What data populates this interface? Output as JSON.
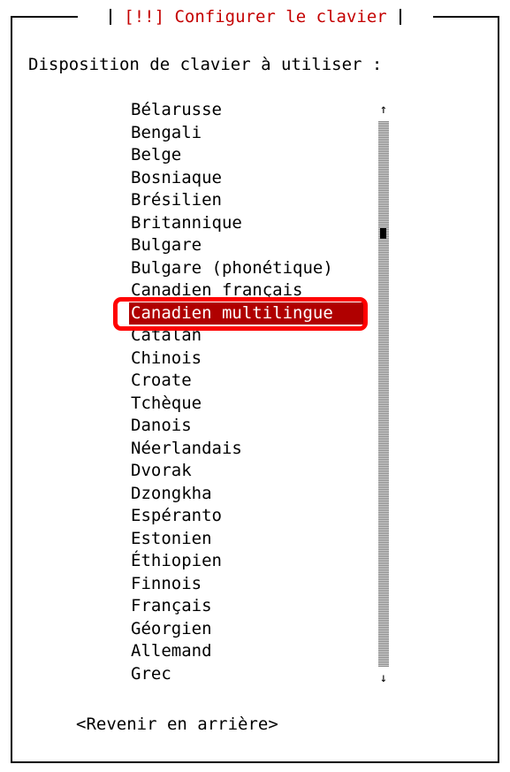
{
  "dialog": {
    "title": "[!!] Configurer le clavier",
    "prompt": "Disposition de clavier à utiliser :",
    "back_label": "<Revenir en arrière>"
  },
  "layouts": [
    "Bélarusse",
    "Bengali",
    "Belge",
    "Bosniaque",
    "Brésilien",
    "Britannique",
    "Bulgare",
    "Bulgare (phonétique)",
    "Canadien français",
    "Canadien multilingue",
    "Catalan",
    "Chinois",
    "Croate",
    "Tchèque",
    "Danois",
    "Néerlandais",
    "Dvorak",
    "Dzongkha",
    "Espéranto",
    "Estonien",
    "Éthiopien",
    "Finnois",
    "Français",
    "Géorgien",
    "Allemand",
    "Grec"
  ],
  "selected_layout": "Canadien multilingue",
  "scrollbar": {
    "up_arrow": "↑",
    "down_arrow": "↓",
    "thumb_position": 0.2
  },
  "colors": {
    "title": "#c40000",
    "selection_background": "#b00000",
    "selection_text": "#ffffff",
    "highlight_outline": "#ff0000"
  },
  "icons": {
    "up": "arrow-up-icon",
    "down": "arrow-down-icon"
  }
}
